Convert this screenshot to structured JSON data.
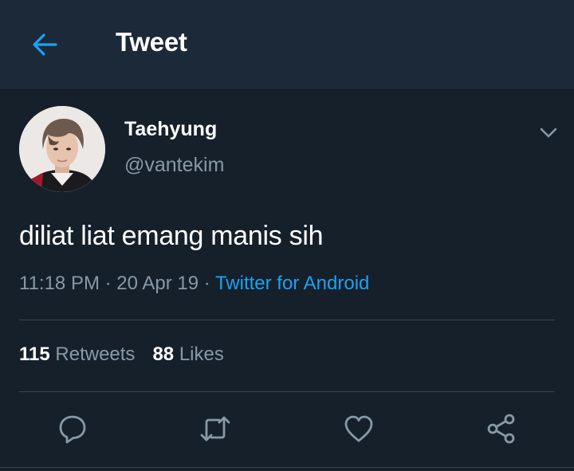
{
  "header": {
    "title": "Tweet",
    "back_icon": "arrow-left-icon"
  },
  "tweet": {
    "display_name": "Taehyung",
    "handle": "@vantekim",
    "text": "diliat liat emang manis sih",
    "time": "11:18 PM",
    "date": "20 Apr 19",
    "separator": "·",
    "source": "Twitter for Android"
  },
  "stats": {
    "retweets_count": "115",
    "retweets_label": "Retweets",
    "likes_count": "88",
    "likes_label": "Likes"
  },
  "actions": [
    "reply-icon",
    "retweet-icon",
    "like-icon",
    "share-icon"
  ],
  "colors": {
    "background": "#15202b",
    "header": "#1c2938",
    "accent": "#1da1f2",
    "secondary_text": "#8899a6",
    "divider": "#38444d"
  }
}
